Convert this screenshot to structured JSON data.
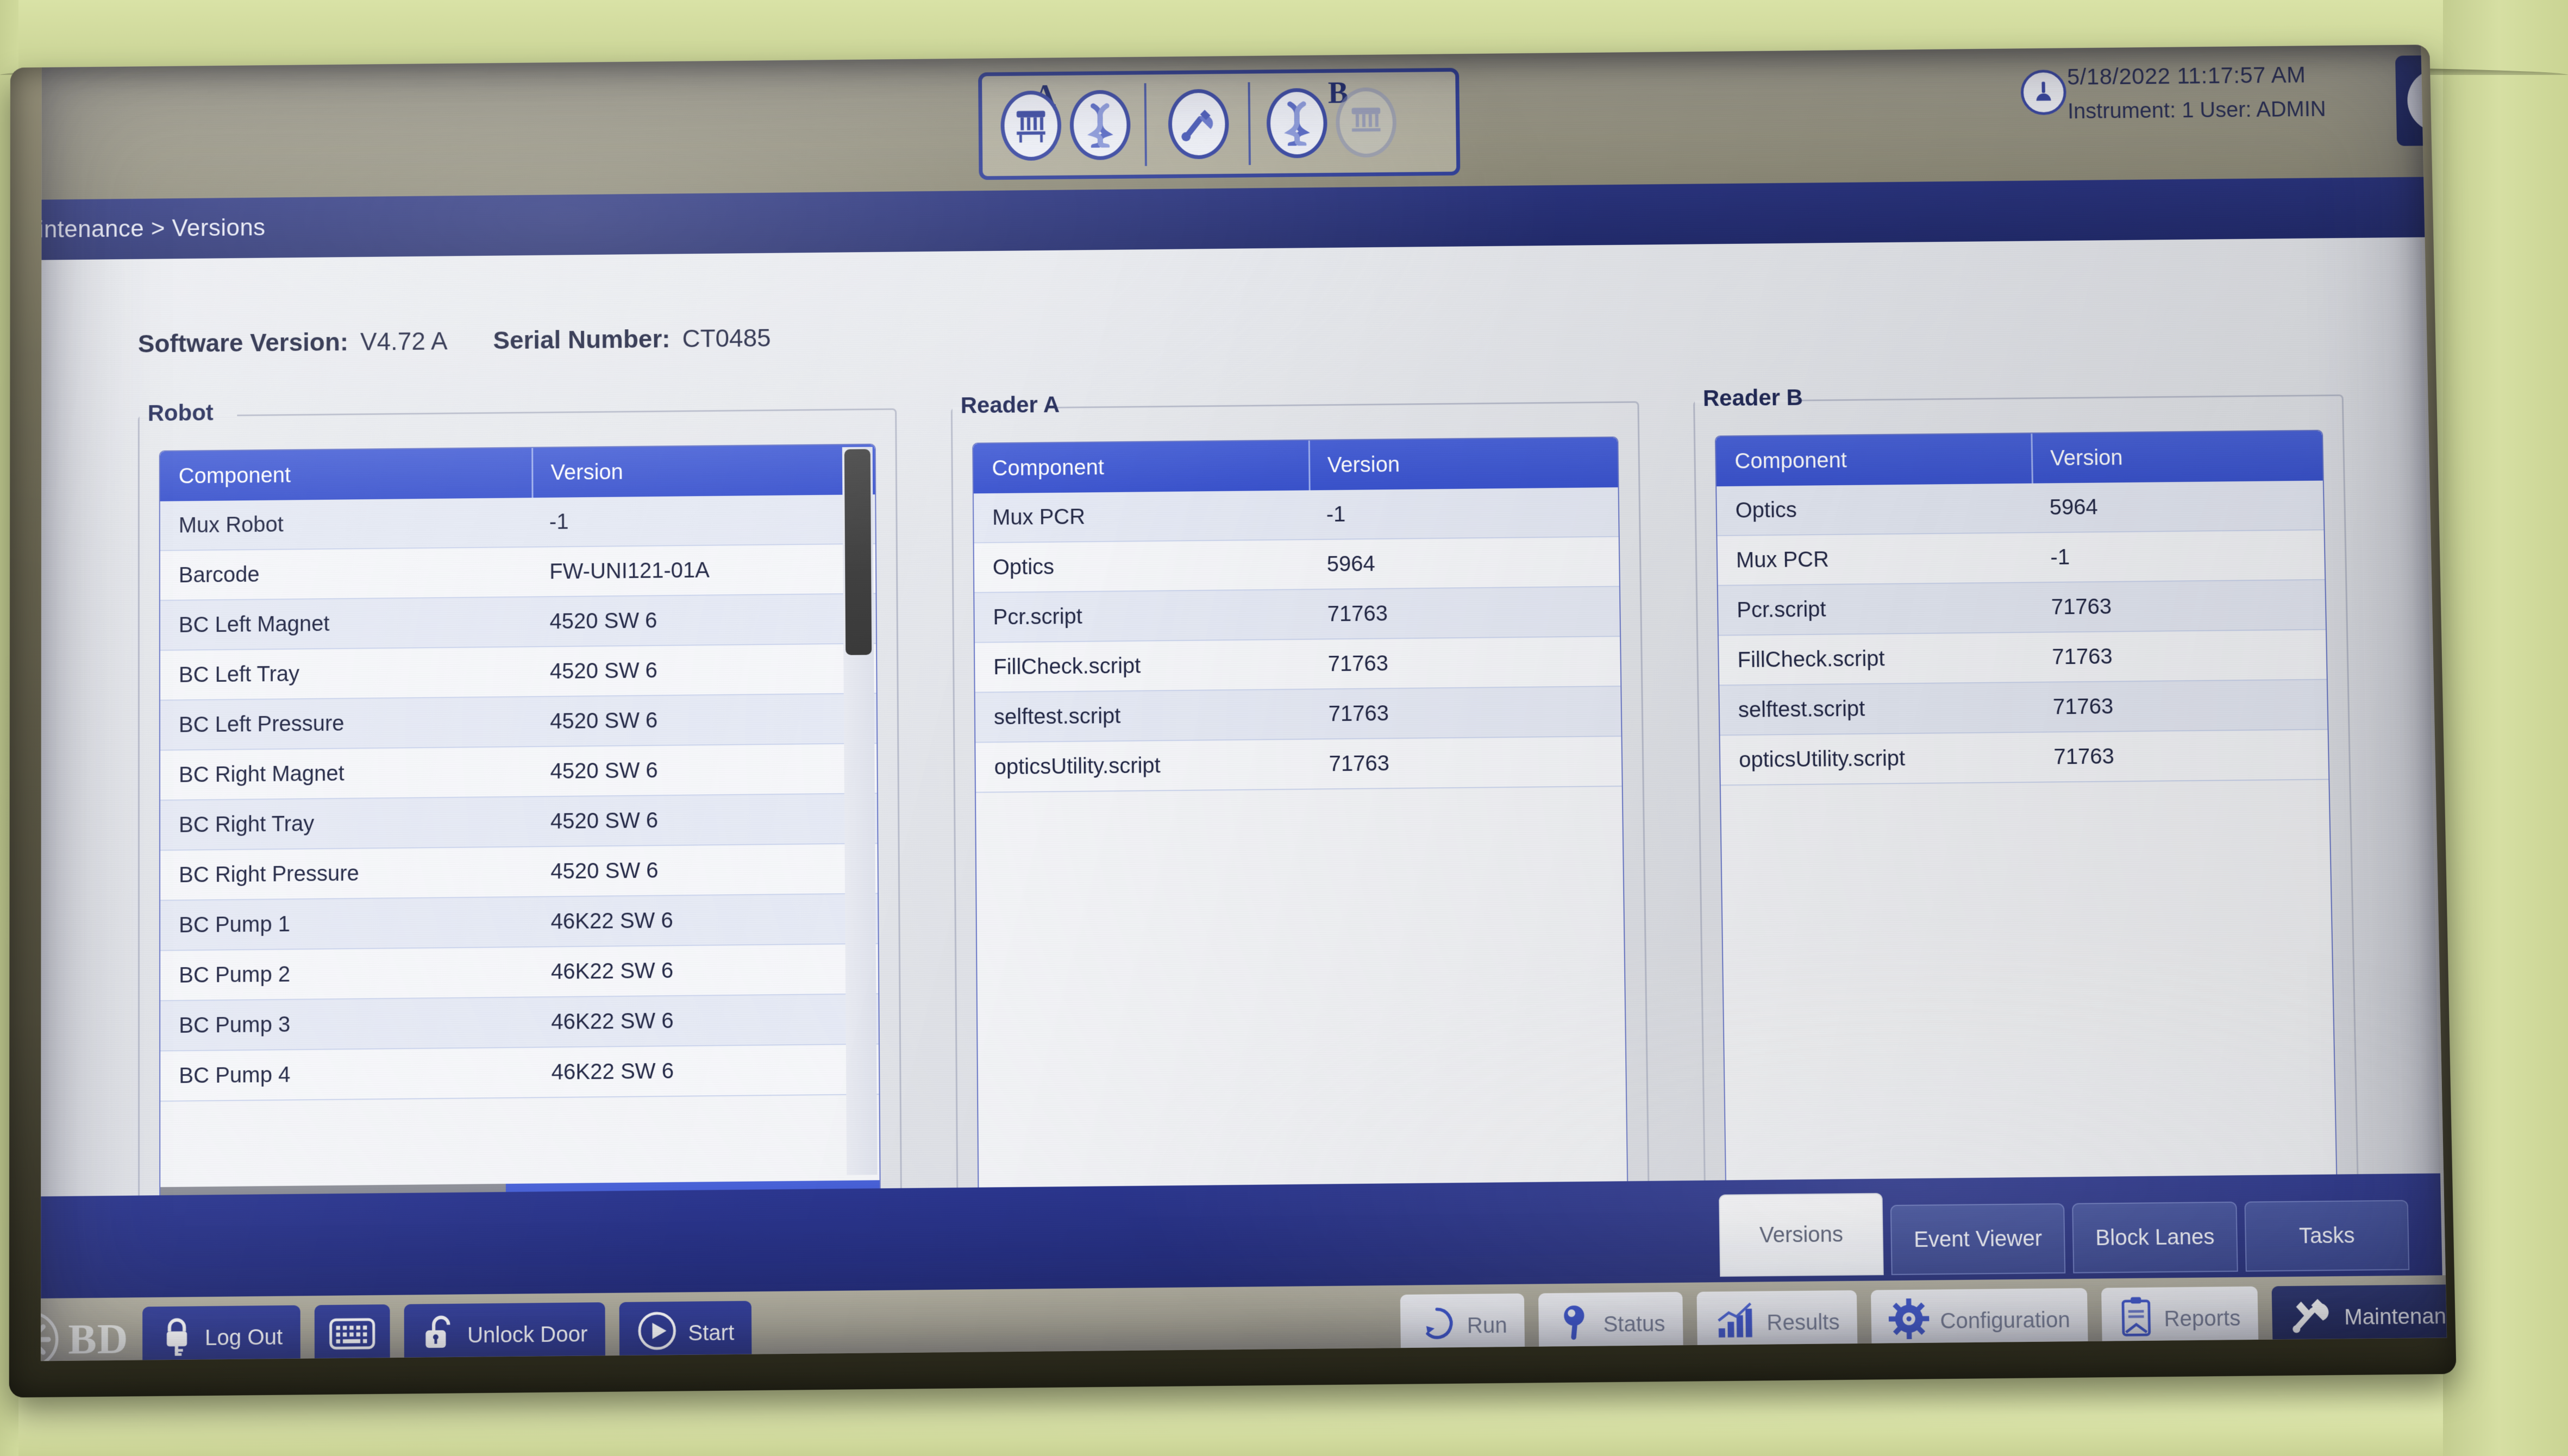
{
  "topbar": {
    "alert_icon": "alert-triangle-icon",
    "status_cluster": {
      "group_a_label": "A",
      "group_b_label": "B",
      "icons": [
        "rack-icon",
        "dna-helix-icon",
        "robot-tool-icon",
        "dna-helix-icon",
        "rack-icon-inactive"
      ]
    },
    "clock_icon": "instrument-status-icon",
    "datetime": "5/18/2022 11:17:57 AM",
    "instrument_user": "Instrument: 1   User: ADMIN",
    "help_label": "?"
  },
  "breadcrumb": "Maintenance > Versions",
  "page": {
    "software_version_label": "Software Version:",
    "software_version_value": "V4.72 A",
    "serial_number_label": "Serial Number:",
    "serial_number_value": "CT0485"
  },
  "panels": [
    {
      "title": "Robot",
      "columns": [
        "Component",
        "Version"
      ],
      "rows": [
        [
          "Mux Robot",
          "-1"
        ],
        [
          "Barcode",
          "FW-UNI121-01A"
        ],
        [
          "BC Left Magnet",
          "4520 SW 6"
        ],
        [
          "BC Left Tray",
          "4520 SW 6"
        ],
        [
          "BC Left Pressure",
          "4520 SW 6"
        ],
        [
          "BC Right Magnet",
          "4520 SW 6"
        ],
        [
          "BC Right Tray",
          "4520 SW 6"
        ],
        [
          "BC Right Pressure",
          "4520 SW 6"
        ],
        [
          "BC Pump 1",
          "46K22 SW 6"
        ],
        [
          "BC Pump 2",
          "46K22 SW 6"
        ],
        [
          "BC Pump 3",
          "46K22 SW 6"
        ],
        [
          "BC Pump 4",
          "46K22 SW 6"
        ]
      ]
    },
    {
      "title": "Reader A",
      "columns": [
        "Component",
        "Version"
      ],
      "rows": [
        [
          "Mux PCR",
          "-1"
        ],
        [
          "Optics",
          "5964"
        ],
        [
          "Pcr.script",
          "71763"
        ],
        [
          "FillCheck.script",
          "71763"
        ],
        [
          "selftest.script",
          "71763"
        ],
        [
          "opticsUtility.script",
          "71763"
        ]
      ]
    },
    {
      "title": "Reader B",
      "columns": [
        "Component",
        "Version"
      ],
      "rows": [
        [
          "Optics",
          "5964"
        ],
        [
          "Mux PCR",
          "-1"
        ],
        [
          "Pcr.script",
          "71763"
        ],
        [
          "FillCheck.script",
          "71763"
        ],
        [
          "selftest.script",
          "71763"
        ],
        [
          "opticsUtility.script",
          "71763"
        ]
      ]
    }
  ],
  "tabs": [
    {
      "label": "Versions",
      "active": true
    },
    {
      "label": "Event Viewer",
      "active": false
    },
    {
      "label": "Block Lanes",
      "active": false
    },
    {
      "label": "Tasks",
      "active": false
    }
  ],
  "toolbar": {
    "brand": "BD",
    "buttons": [
      {
        "label": "Log Out",
        "icon": "lock-key-icon",
        "style": "blue"
      },
      {
        "label": "",
        "icon": "keyboard-icon",
        "style": "blue"
      },
      {
        "label": "Unlock Door",
        "icon": "unlock-icon",
        "style": "blue"
      },
      {
        "label": "Start",
        "icon": "play-icon",
        "style": "blue"
      }
    ],
    "nav": [
      {
        "label": "Run",
        "icon": "run-cycle-icon",
        "style": "white"
      },
      {
        "label": "Status",
        "icon": "magnifier-icon",
        "style": "white"
      },
      {
        "label": "Results",
        "icon": "bar-chart-icon",
        "style": "white"
      },
      {
        "label": "Configuration",
        "icon": "gear-icon",
        "style": "white"
      },
      {
        "label": "Reports",
        "icon": "clipboard-icon",
        "style": "white"
      },
      {
        "label": "Maintenance",
        "icon": "wrench-screwdriver-icon",
        "style": "navy",
        "active": true
      }
    ]
  },
  "colors": {
    "accent_blue": "#3b54cf",
    "header_navy": "#2b3580",
    "table_row_alt": "#e6eaf5",
    "toolbar_gray": "#a7a494"
  }
}
